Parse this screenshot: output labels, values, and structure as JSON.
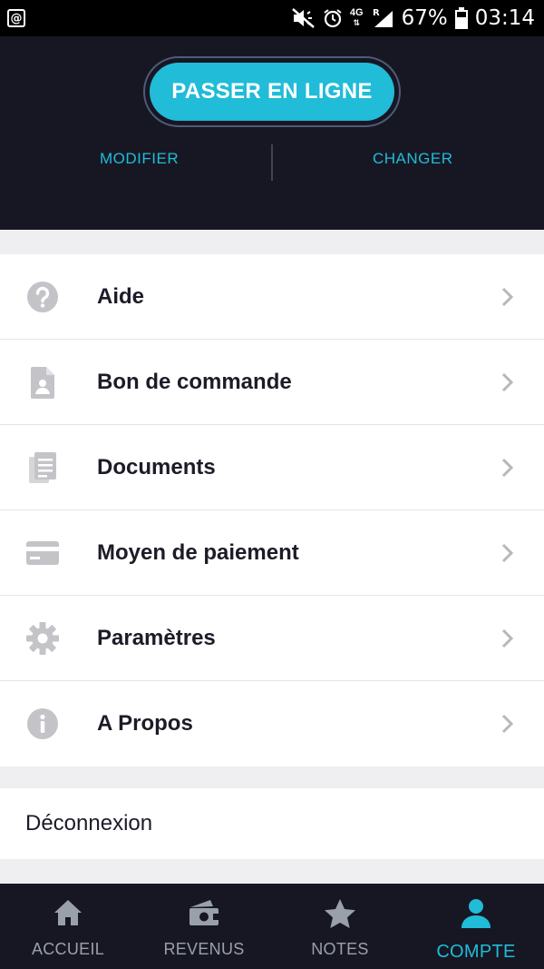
{
  "status_bar": {
    "notification_icon": "at-icon",
    "network": "4G",
    "roaming": "R",
    "battery": "67%",
    "time": "03:14"
  },
  "header": {
    "online_button": "PASSER EN LIGNE",
    "modify_link": "MODIFIER",
    "change_link": "CHANGER"
  },
  "menu": {
    "items": [
      {
        "label": "Aide",
        "icon": "help-icon"
      },
      {
        "label": "Bon de commande",
        "icon": "document-person-icon"
      },
      {
        "label": "Documents",
        "icon": "documents-icon"
      },
      {
        "label": "Moyen de paiement",
        "icon": "credit-card-icon"
      },
      {
        "label": "Paramètres",
        "icon": "gear-icon"
      },
      {
        "label": "A Propos",
        "icon": "info-icon"
      }
    ],
    "logout": "Déconnexion"
  },
  "bottom_nav": {
    "items": [
      {
        "label": "ACCUEIL",
        "icon": "home-icon"
      },
      {
        "label": "REVENUS",
        "icon": "wallet-icon"
      },
      {
        "label": "NOTES",
        "icon": "star-icon"
      },
      {
        "label": "COMPTE",
        "icon": "person-icon"
      }
    ],
    "active": "COMPTE"
  },
  "colors": {
    "accent": "#20bcd8",
    "header_bg": "#171723",
    "icon_gray": "#c4c4c8"
  }
}
